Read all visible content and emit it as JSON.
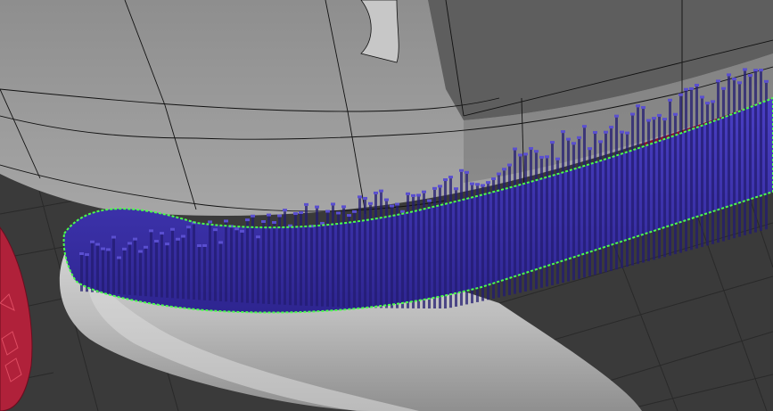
{
  "viewport": {
    "background_color": "#3a3a3a",
    "grid_color": "#222222"
  },
  "scene": {
    "mesh_body_color": "#9a9a9a",
    "mesh_shadow_color": "#5a5a5a",
    "mesh_edge_color": "#111111",
    "cylinder_color": "#bdbdbd",
    "voxel_selection_color": "#3b2fa3",
    "voxel_highlight_color": "#5a4fd0",
    "selection_outline_color": "#4cff4c",
    "red_object_color": "#b0213a",
    "icons": [
      "voxel-strip-icon",
      "selection-outline-icon"
    ]
  }
}
